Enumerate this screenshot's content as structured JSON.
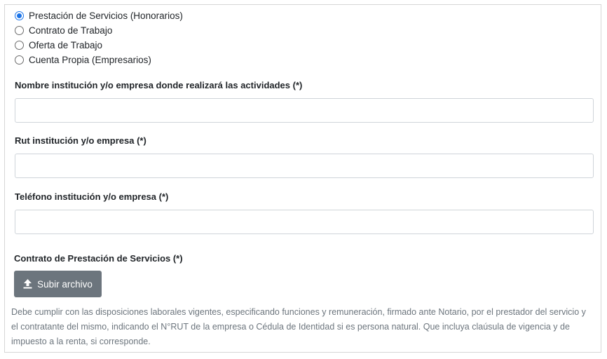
{
  "work_type_options": [
    {
      "label": "Prestación de Servicios (Honorarios)",
      "checked": true
    },
    {
      "label": "Contrato de Trabajo",
      "checked": false
    },
    {
      "label": "Oferta de Trabajo",
      "checked": false
    },
    {
      "label": "Cuenta Propia (Empresarios)",
      "checked": false
    }
  ],
  "fields": {
    "institution_name_label": "Nombre institución y/o empresa donde realizará las actividades (*)",
    "institution_name_value": "",
    "rut_label": "Rut institución y/o empresa (*)",
    "rut_value": "",
    "phone_label": "Teléfono institución y/o empresa (*)",
    "phone_value": ""
  },
  "contract": {
    "label": "Contrato de Prestación de Servicios (*)",
    "upload_button": "Subir archivo",
    "help_text": "Debe cumplir con las disposiciones laborales vigentes, especificando funciones y remuneración, firmado ante Notario, por el prestador del servicio y el contratante del mismo, indicando el N°RUT de la empresa o Cédula de Identidad si es persona natural. Que incluya claúsula de vigencia y de impuesto a la renta, si corresponde."
  },
  "colors": {
    "radio_accent": "#1a73e8",
    "button_bg": "#6c757d",
    "help_text": "#6c757d"
  }
}
